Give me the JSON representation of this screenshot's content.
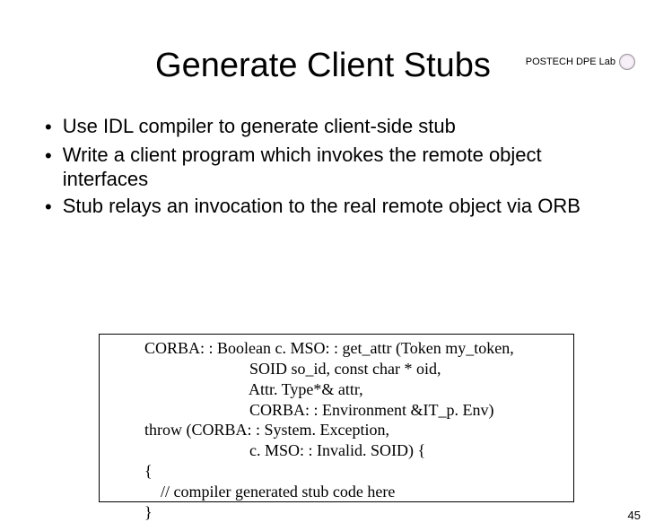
{
  "header": {
    "lab": "POSTECH DPE Lab"
  },
  "title": "Generate Client Stubs",
  "bullets": [
    "Use IDL compiler to generate client-side stub",
    "Write a client program which invokes the remote object interfaces",
    "Stub relays an invocation to the real remote object via ORB"
  ],
  "code": {
    "l1": "CORBA: : Boolean c. MSO: : get_attr (Token my_token,",
    "l2": "                          SOID so_id, const char * oid,",
    "l3": "                          Attr. Type*& attr,",
    "l4": "                          CORBA: : Environment &IT_p. Env)",
    "l5": "throw (CORBA: : System. Exception,",
    "l6": "                          c. MSO: : Invalid. SOID) {",
    "l7": "{",
    "l8": "    // compiler generated stub code here",
    "l9": "}"
  },
  "page_number": "45"
}
